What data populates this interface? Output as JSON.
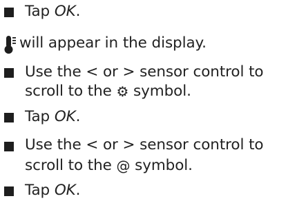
{
  "steps": [
    {
      "type": "bullet",
      "prefix": "Tap ",
      "emph": "OK",
      "suffix": "."
    },
    {
      "type": "note",
      "icon": "thermometer-icon",
      "text": " will appear in the display."
    },
    {
      "type": "bullet",
      "line1": "Use the < or > sensor control to",
      "line2_prefix": "scroll to the ",
      "symbol": "⚙",
      "symbol_name": "settings-gear-icon",
      "line2_suffix": " symbol."
    },
    {
      "type": "bullet",
      "prefix": "Tap ",
      "emph": "OK",
      "suffix": "."
    },
    {
      "type": "bullet",
      "line1": "Use the < or > sensor control to",
      "line2_prefix": "scroll to the ",
      "symbol": "@",
      "symbol_name": "at-symbol-icon",
      "line2_suffix": " symbol."
    },
    {
      "type": "bullet",
      "prefix": "Tap ",
      "emph": "OK",
      "suffix": "."
    }
  ]
}
